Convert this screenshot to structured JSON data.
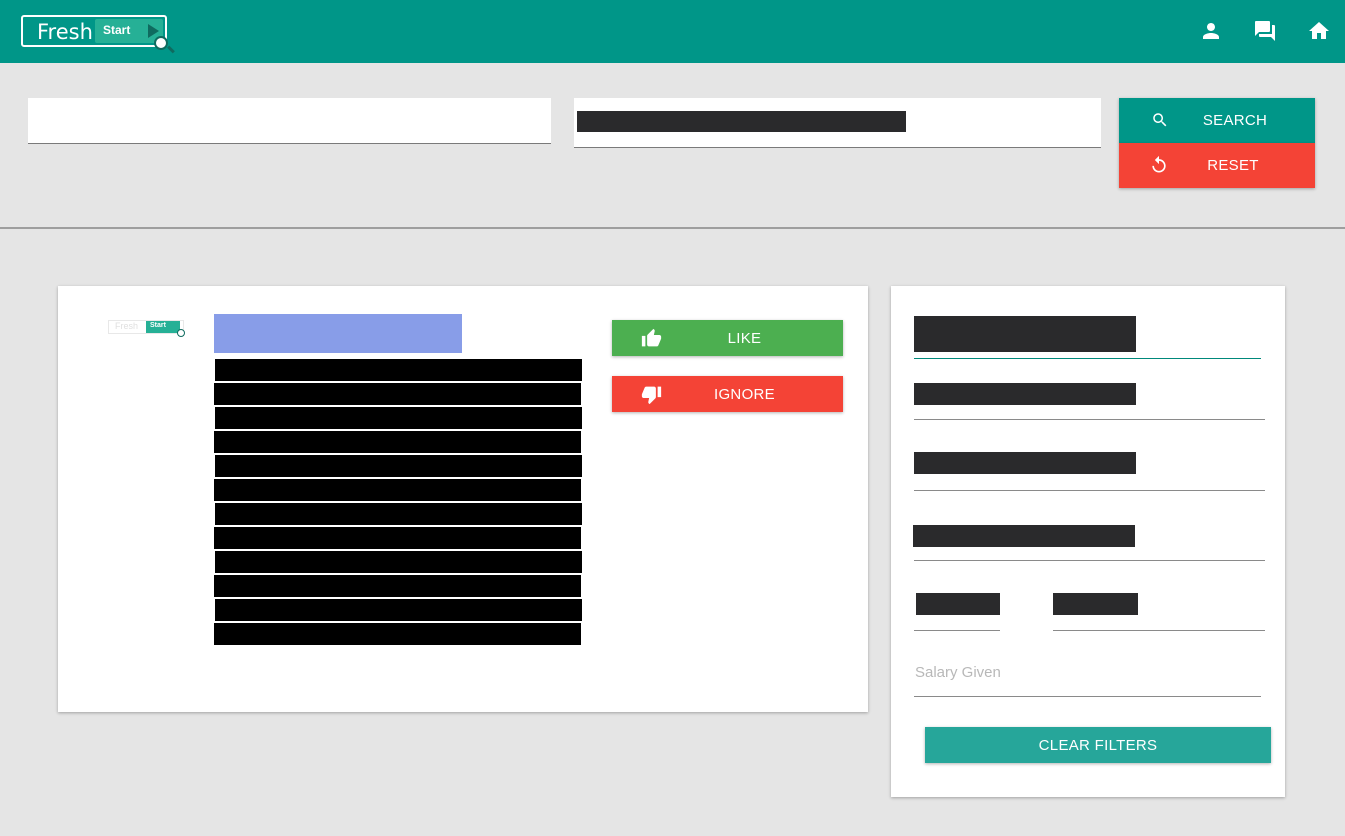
{
  "header": {
    "logo": {
      "word": "Fresh",
      "badge": "Start"
    },
    "icons": [
      "account-icon",
      "forum-icon",
      "home-icon"
    ]
  },
  "search": {
    "search_label": "SEARCH",
    "reset_label": "RESET"
  },
  "job": {
    "like_label": "LIKE",
    "ignore_label": "IGNORE"
  },
  "filters": {
    "salary_label": "Salary Given",
    "clear_label": "CLEAR FILTERS"
  },
  "colors": {
    "primary": "#009688",
    "danger": "#f44336",
    "success": "#4caf50",
    "accent": "#26a69a",
    "highlight": "#889de8"
  }
}
